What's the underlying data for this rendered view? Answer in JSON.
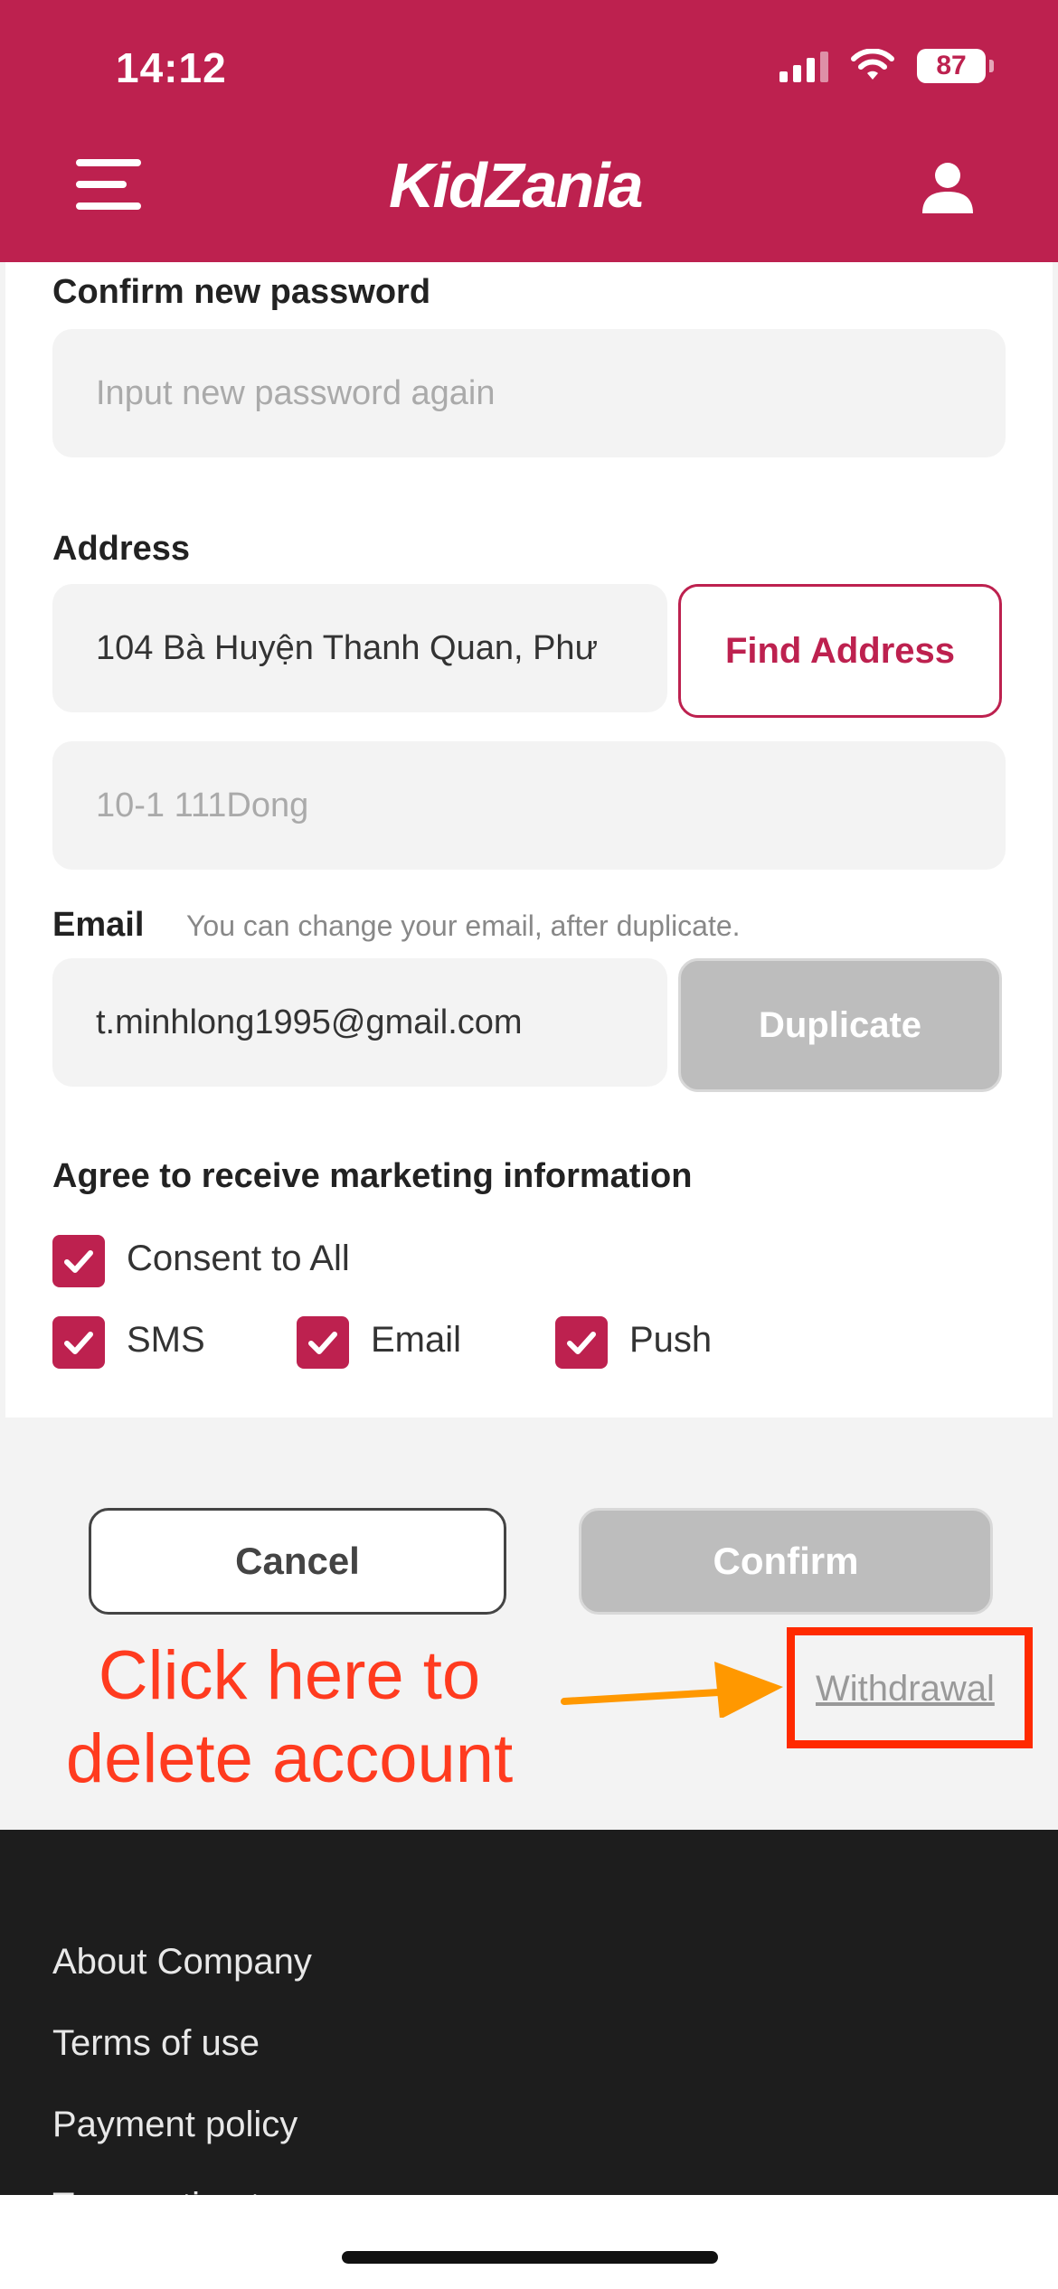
{
  "status_bar": {
    "time": "14:12",
    "battery": "87"
  },
  "header": {
    "logo": "KidZania",
    "icons": {
      "menu": "hamburger-menu-icon",
      "account": "user-icon"
    }
  },
  "form": {
    "confirm_password": {
      "label": "Confirm new password",
      "placeholder": "Input new password again"
    },
    "address": {
      "label": "Address",
      "value": "104 Bà Huyện Thanh Quan, Phư",
      "find_button": "Find Address",
      "detail_placeholder": "10-1 111Dong"
    },
    "email": {
      "label": "Email",
      "hint": "You can change your email, after duplicate.",
      "value": "t.minhlong1995@gmail.com",
      "duplicate_button": "Duplicate"
    },
    "marketing": {
      "label": "Agree to receive marketing information",
      "consent_all": "Consent to All",
      "sms": "SMS",
      "email": "Email",
      "push": "Push"
    }
  },
  "actions": {
    "cancel": "Cancel",
    "confirm": "Confirm",
    "withdrawal": "Withdrawal"
  },
  "annotation": {
    "line1": "Click here to",
    "line2": "delete account"
  },
  "footer": {
    "links": [
      "About Company",
      "Terms of use",
      "Payment policy",
      "Transaction terms"
    ]
  },
  "colors": {
    "brand": "#bd214f",
    "annotation": "#ff3b1f",
    "arrow": "#ff9800"
  }
}
